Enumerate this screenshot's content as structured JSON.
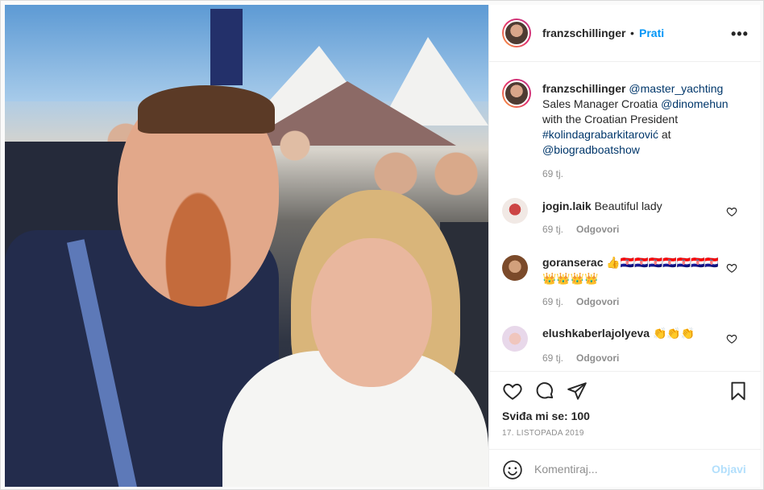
{
  "post": {
    "username": "franzschillinger",
    "dot": "•",
    "follow_label": "Prati",
    "more_icon": "more-options-icon"
  },
  "caption": {
    "username": "franzschillinger",
    "mention1": "@master_yachting",
    "text1": "Sales Manager Croatia",
    "mention2": "@dinomehun",
    "text2": "with the Croatian President",
    "hashtag": "#kolindagrabarkitarović",
    "text3": "at",
    "mention3": "@biogradboatshow",
    "time": "69 tj."
  },
  "comments": [
    {
      "username": "jogin.laik",
      "text": "Beautiful lady",
      "time": "69 tj.",
      "reply": "Odgovori"
    },
    {
      "username": "goranserac",
      "text": "👍🇭🇷🇭🇷🇭🇷🇭🇷🇭🇷🇭🇷🇭🇷👑👑👑👑",
      "time": "69 tj.",
      "reply": "Odgovori"
    },
    {
      "username": "elushkaberlajolyeva",
      "text": "👏👏👏",
      "time": "69 tj.",
      "reply": "Odgovori"
    }
  ],
  "likes": "Sviđa mi se: 100",
  "date": "17. LISTOPADA 2019",
  "comment_input": {
    "placeholder": "Komentiraj..."
  },
  "post_button": "Objavi",
  "colors": {
    "accent": "#0095f6",
    "link": "#00376b",
    "muted": "#8e8e8e",
    "post_disabled": "#b2dffc"
  }
}
